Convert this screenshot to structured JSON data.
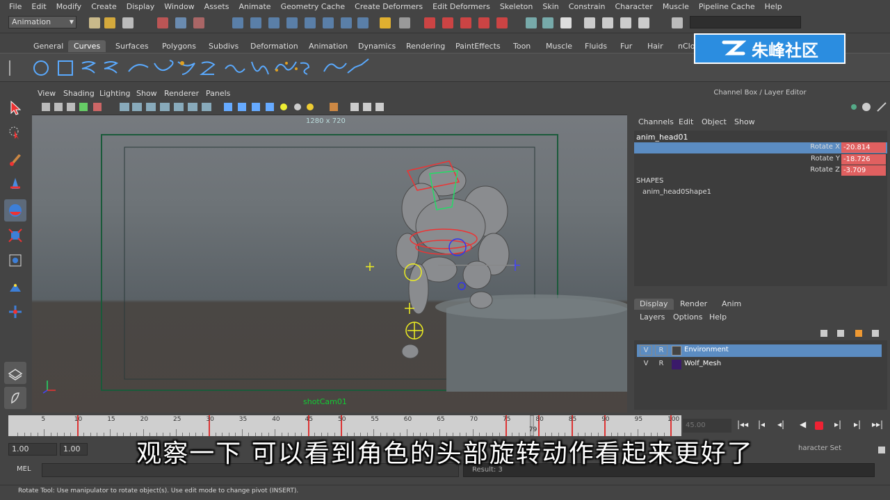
{
  "menubar": [
    "File",
    "Edit",
    "Modify",
    "Create",
    "Display",
    "Window",
    "Assets",
    "Animate",
    "Geometry Cache",
    "Create Deformers",
    "Edit Deformers",
    "Skeleton",
    "Skin",
    "Constrain",
    "Character",
    "Muscle",
    "Pipeline Cache",
    "Help"
  ],
  "status_line": {
    "mode": "Animation"
  },
  "shelf_tabs": [
    "General",
    "Curves",
    "Surfaces",
    "Polygons",
    "Subdivs",
    "Deformation",
    "Animation",
    "Dynamics",
    "Rendering",
    "PaintEffects",
    "Toon",
    "Muscle",
    "Fluids",
    "Fur",
    "Hair",
    "nClo"
  ],
  "shelf_active": "Curves",
  "watermark": {
    "text": "朱峰社区"
  },
  "viewport": {
    "menu": [
      "View",
      "Shading",
      "Lighting",
      "Show",
      "Renderer",
      "Panels"
    ],
    "resolution_label": "1280 x 720",
    "camera_label": "shotCam01"
  },
  "channel_box": {
    "title": "Channel Box / Layer Editor",
    "menu": [
      "Channels",
      "Edit",
      "Object",
      "Show"
    ],
    "object": "anim_head01",
    "channels": [
      {
        "attr": "Rotate X",
        "value": "-20.814"
      },
      {
        "attr": "Rotate Y",
        "value": "-18.726"
      },
      {
        "attr": "Rotate Z",
        "value": "-3.709"
      }
    ],
    "shapes_label": "SHAPES",
    "shape_name": "anim_head0Shape1"
  },
  "layer_editor": {
    "tabs": [
      "Display",
      "Render",
      "Anim"
    ],
    "active_tab": "Display",
    "menu": [
      "Layers",
      "Options",
      "Help"
    ],
    "layers": [
      {
        "v": "V",
        "r": "R",
        "name": "Environment",
        "selected": true
      },
      {
        "v": "V",
        "r": "R",
        "name": "Wolf_Mesh",
        "selected": false,
        "color": "#3a1a6a"
      }
    ]
  },
  "timeline": {
    "ticks": [
      "5",
      "10",
      "15",
      "20",
      "25",
      "30",
      "35",
      "40",
      "45",
      "50",
      "55",
      "60",
      "65",
      "70",
      "75",
      "80",
      "85",
      "90",
      "95",
      "100"
    ],
    "current_frame": "79",
    "frame_field": "45.00"
  },
  "range": {
    "start": "1.00",
    "start2": "1.00",
    "character_set": "haracter Set"
  },
  "command": {
    "label": "MEL",
    "result": "Result: 3"
  },
  "help_line": "Rotate Tool: Use manipulator to rotate object(s). Use edit mode to change pivot (INSERT).",
  "subtitle": "观察一下  可以看到角色的头部旋转动作看起来更好了"
}
